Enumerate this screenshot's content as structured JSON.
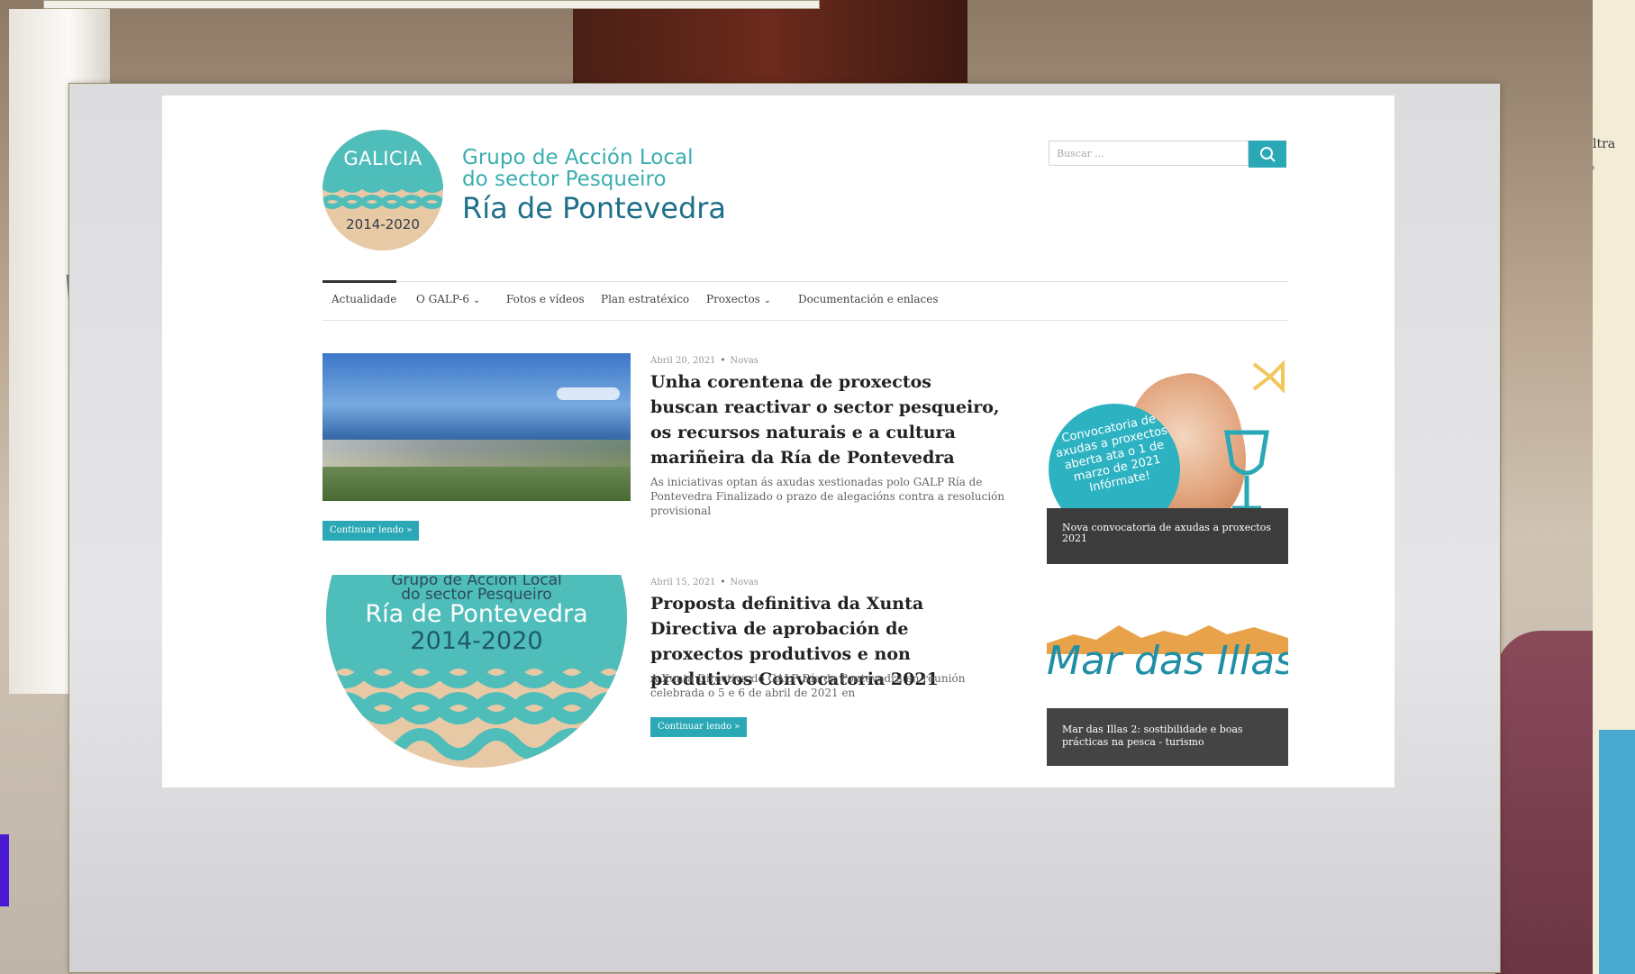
{
  "site": {
    "logo": {
      "region": "GALICIA",
      "years": "2014-2020",
      "line1": "Grupo de Acción Local",
      "line2": "do sector Pesqueiro",
      "line3": "Ría de Pontevedra"
    },
    "search": {
      "placeholder": "Buscar ..."
    },
    "nav": [
      {
        "label": "Actualidade",
        "active": true
      },
      {
        "label": "O GALP-6",
        "has_dropdown": true
      },
      {
        "label": "Fotos e vídeos"
      },
      {
        "label": "Plan estratéxico"
      },
      {
        "label": "Proxectos",
        "has_dropdown": true
      },
      {
        "label": "Documentación e enlaces"
      }
    ]
  },
  "posts": [
    {
      "date": "Abril 20, 2021",
      "category": "Novas",
      "title": "Unha corentena de proxectos buscan reactivar o sector pesqueiro, os recursos naturais e a cultura mariñeira da Ría de Pontevedra",
      "excerpt": "As iniciativas optan ás axudas xestionadas polo GALP Ría de Pontevedra Finalizado o prazo de alegacións contra a resolución provisional",
      "more": "Continuar lendo »"
    },
    {
      "date": "Abril 15, 2021",
      "category": "Novas",
      "title": "Proposta definitiva da Xunta Directiva de aprobación de proxectos produtivos e non produtivos Convocatoria 2021",
      "excerpt": "A Xunta Directiva do GALP Ría de Pontevedra en reunión celebrada o 5 e 6 de abril de 2021 en",
      "more": "Continuar lendo »",
      "thumb": {
        "line1": "Grupo de Acción Local",
        "line2": "do sector Pesqueiro",
        "line3": "Ría de Pontevedra",
        "line4": "2014-2020"
      }
    }
  ],
  "sidebar": {
    "widget1": {
      "badge": "Convocatoria de axudas a proxectos aberta ata o 1 de marzo de 2021 Infórmate!",
      "caption": "Nova convocatoria de axudas a proxectos 2021"
    },
    "widget2": {
      "logo_text": "Mar das Illas",
      "caption": "Mar das Illas 2: sostibilidade e boas prácticas na pesca - turismo"
    }
  },
  "background": {
    "edge_text": "ltra"
  },
  "colors": {
    "accent": "#2aa8b5",
    "logo_teal": "#4fbdb9",
    "logo_sand": "#e8c9a6",
    "caption_bg": "#3c3c3c"
  },
  "icons": [
    "search-icon",
    "chevron-down-icon"
  ]
}
